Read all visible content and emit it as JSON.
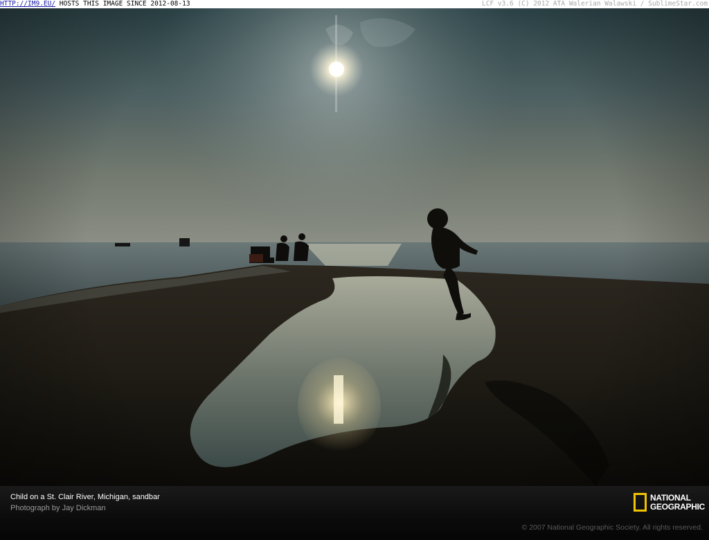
{
  "banner": {
    "link_text": "HTTP://IM9.EU/",
    "host_text": " HOSTS THIS IMAGE SINCE 2012-08-13",
    "right_text": "LCF v3.6 (C) 2012 ATA Walerian Walawski / SublimeStar.com"
  },
  "caption": {
    "title": "Child on a St. Clair River, Michigan, sandbar",
    "credit": "Photograph by Jay Dickman",
    "copyright": "© 2007 National Geographic Society. All rights reserved."
  },
  "logo": {
    "line1": "NATIONAL",
    "line2": "GEOGRAPHIC",
    "frame_color": "#f2c500"
  },
  "photo": {
    "sky_top_color": "#2f4448",
    "horizon_color": "#8a8f86",
    "sand_color": "#1f1c15"
  }
}
